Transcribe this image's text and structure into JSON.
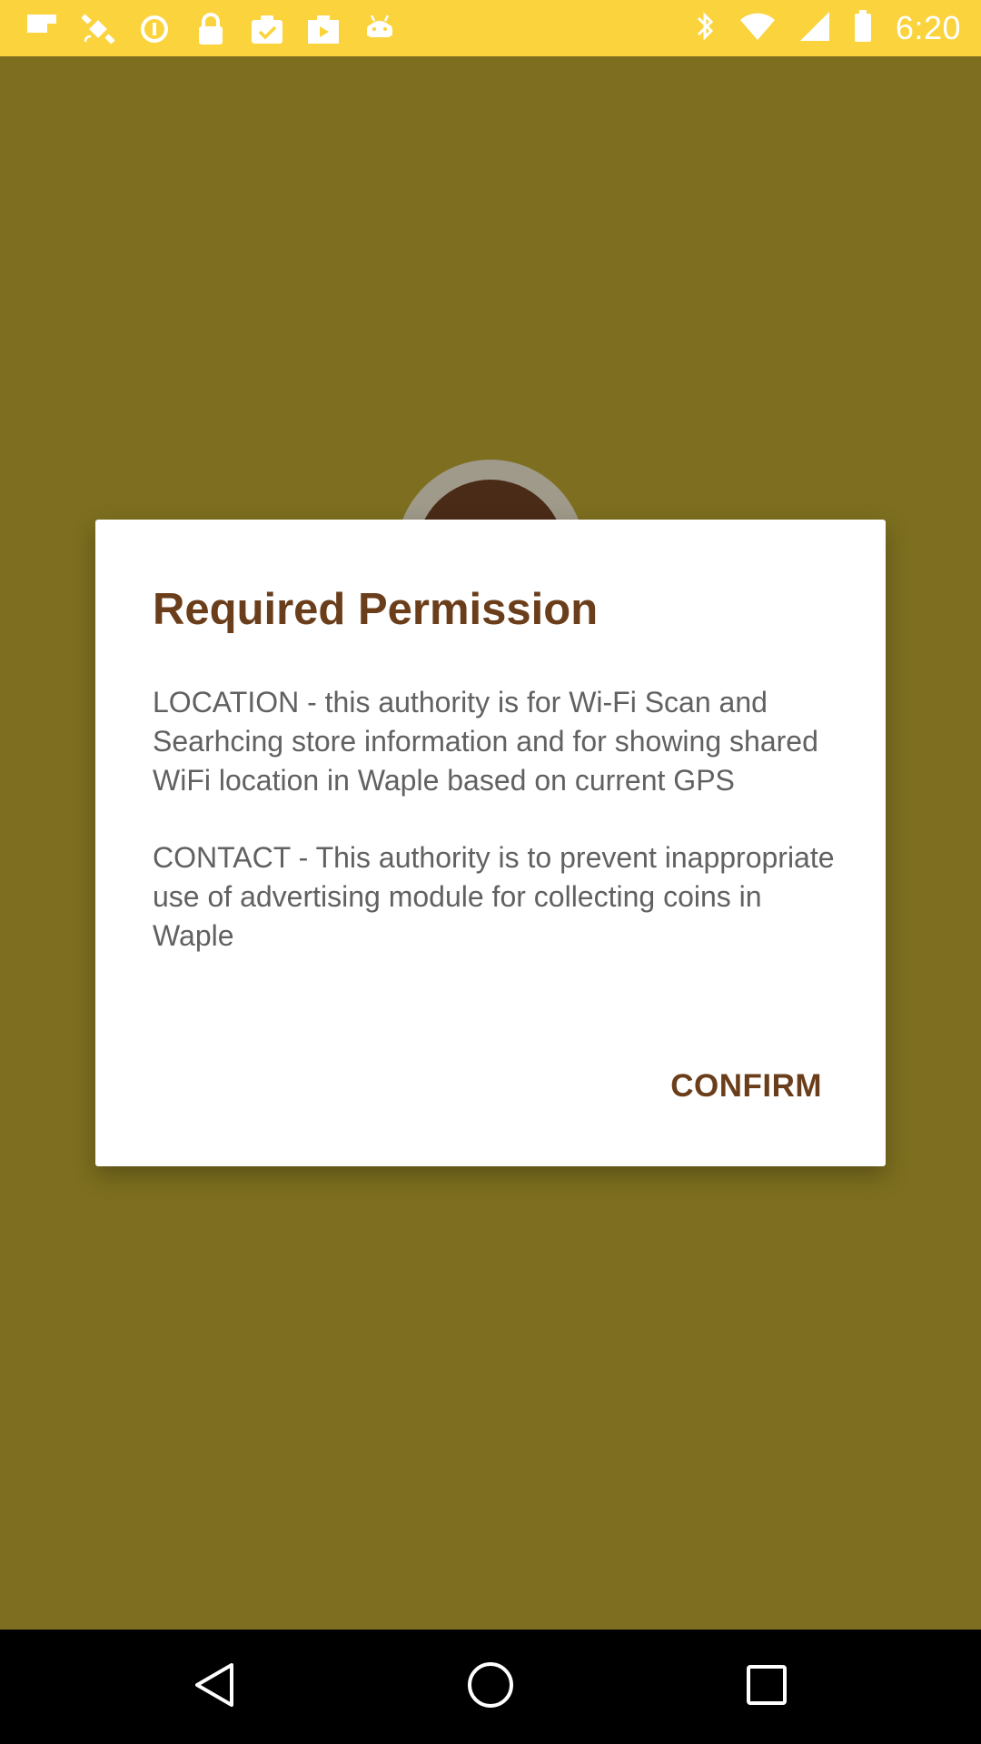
{
  "status_bar": {
    "time": "6:20",
    "background_color": "#fbd33c",
    "notification_icons": [
      "flipboard-icon",
      "fake-gps-icon",
      "data-saver-icon",
      "lock-icon",
      "task-done-icon",
      "play-store-icon",
      "android-icon"
    ],
    "system_icons": [
      "bluetooth-icon",
      "wifi-icon",
      "signal-icon",
      "battery-icon"
    ]
  },
  "background": {
    "color": "#7d6f1f",
    "logo_icon": "app-logo"
  },
  "dialog": {
    "title": "Required Permission",
    "paragraphs": [
      "LOCATION - this authority is for Wi-Fi Scan and Searhcing store information and for showing shared WiFi location in Waple based on current GPS",
      "CONTACT - This authority is to prevent inappropriate use of advertising module for collecting coins in Waple"
    ],
    "confirm_label": "CONFIRM",
    "accent_color": "#6b3e1b"
  },
  "nav_bar": {
    "buttons": [
      "back-icon",
      "home-icon",
      "recents-icon"
    ]
  }
}
